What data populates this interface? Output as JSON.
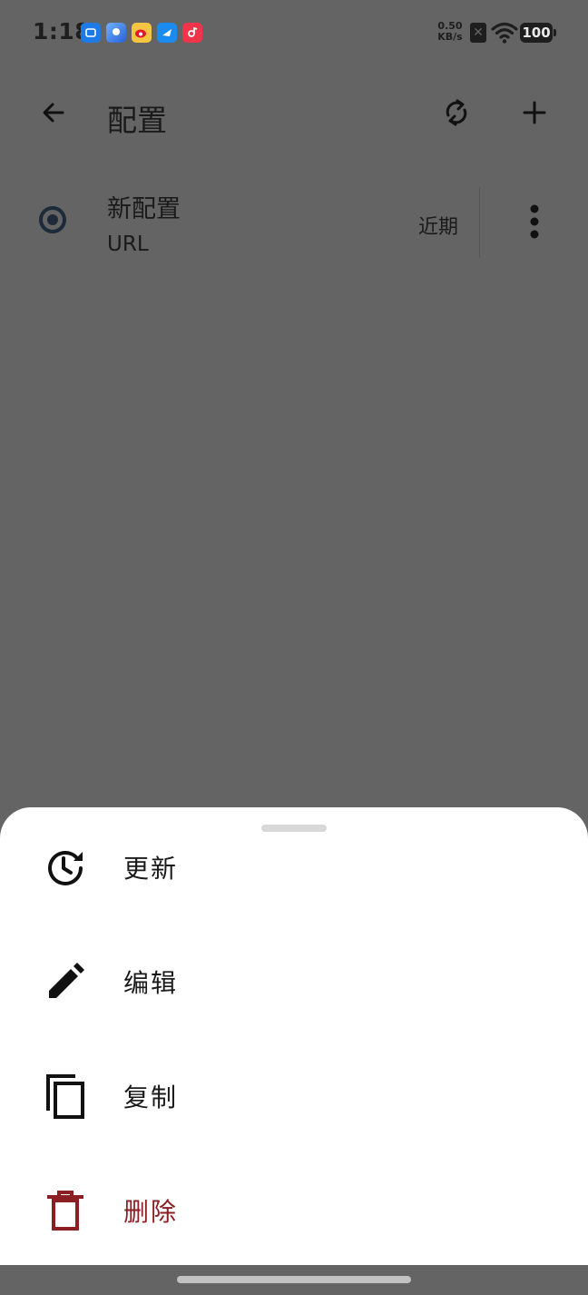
{
  "status_bar": {
    "time": "1:18",
    "net_speed_value": "0.50",
    "net_speed_unit": "KB/s",
    "battery": "100",
    "notification_icons": [
      "app-notification-icon-1",
      "app-notification-icon-2",
      "weibo-icon",
      "app-notification-icon-4",
      "app-notification-icon-5"
    ]
  },
  "app_bar": {
    "title": "配置",
    "back_icon": "arrow-back-icon",
    "sync_icon": "sync-icon",
    "add_icon": "plus-icon"
  },
  "profile": {
    "name": "新配置",
    "type": "URL",
    "updated": "近期",
    "selected": true
  },
  "sheet": {
    "items": [
      {
        "label": "更新",
        "icon": "update-clock-icon"
      },
      {
        "label": "编辑",
        "icon": "pencil-icon"
      },
      {
        "label": "复制",
        "icon": "copy-icon"
      },
      {
        "label": "删除",
        "icon": "trash-icon"
      }
    ],
    "danger_color": "#8b1f24"
  },
  "colors": {
    "scrim": "#646464",
    "sheet_bg": "#ffffff",
    "radio": "#1c2a3a"
  }
}
